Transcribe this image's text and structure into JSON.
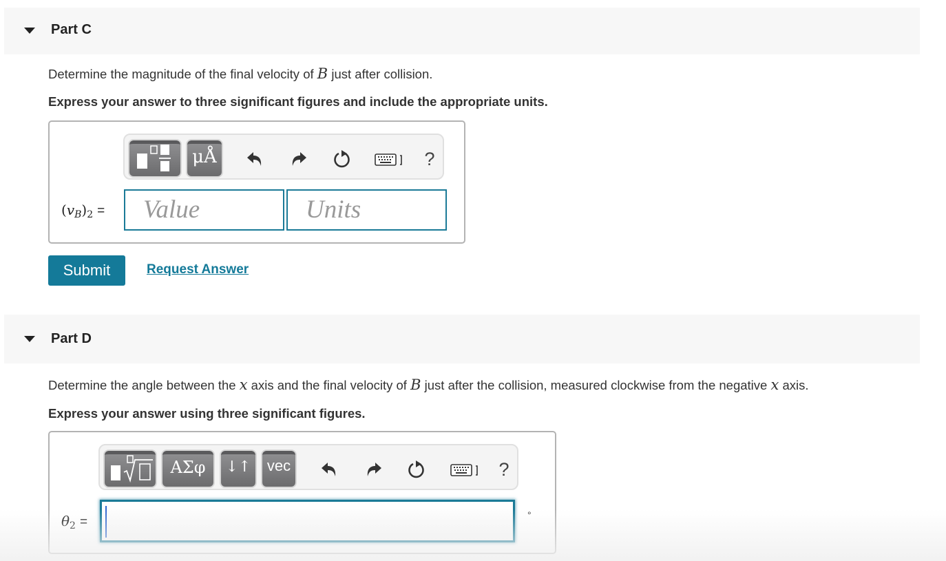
{
  "parts": [
    {
      "id": "C",
      "title": "Part C",
      "prompt": {
        "before": "Determine the magnitude of the final velocity of ",
        "var": "B",
        "after": " just after collision."
      },
      "instruction": "Express your answer to three significant figures and include the appropriate units.",
      "answer_label": {
        "open": "(",
        "var": "v",
        "sub": "B",
        "close": ")",
        "outer_sub": "2",
        "eq": "="
      },
      "toolbar": {
        "buttons": [
          {
            "name": "templates",
            "icon": "fraction-template-icon"
          },
          {
            "name": "units",
            "label": "μÅ"
          }
        ],
        "tools": [
          "undo-icon",
          "redo-icon",
          "reset-icon",
          "keyboard-icon"
        ],
        "help_label": "?"
      },
      "inputs": {
        "value_placeholder": "Value",
        "units_placeholder": "Units",
        "value": "",
        "units": ""
      },
      "submit_label": "Submit",
      "request_answer_label": "Request Answer"
    },
    {
      "id": "D",
      "title": "Part D",
      "prompt": {
        "s1": "Determine the angle between the ",
        "x1": "x",
        "s2": " axis and the final velocity of ",
        "var": "B",
        "s3": " just after the collision, measured clockwise from the negative ",
        "x2": "x",
        "s4": " axis."
      },
      "instruction": "Express your answer using three significant figures.",
      "answer_label": {
        "var": "θ",
        "sub": "2",
        "eq": "="
      },
      "toolbar": {
        "buttons": [
          {
            "name": "templates",
            "icon": "root-template-icon"
          },
          {
            "name": "greek",
            "label": "ΑΣφ"
          },
          {
            "name": "arrows",
            "label": "↓↑"
          },
          {
            "name": "vec",
            "label": "vec"
          }
        ],
        "tools": [
          "undo-icon",
          "redo-icon",
          "reset-icon",
          "keyboard-icon"
        ],
        "help_label": "?"
      },
      "input_value": "",
      "unit_suffix": "°"
    }
  ],
  "colors": {
    "accent": "#147a99",
    "header_bg": "#f7f7f7",
    "toolbar_button": "#7a7a7c"
  }
}
